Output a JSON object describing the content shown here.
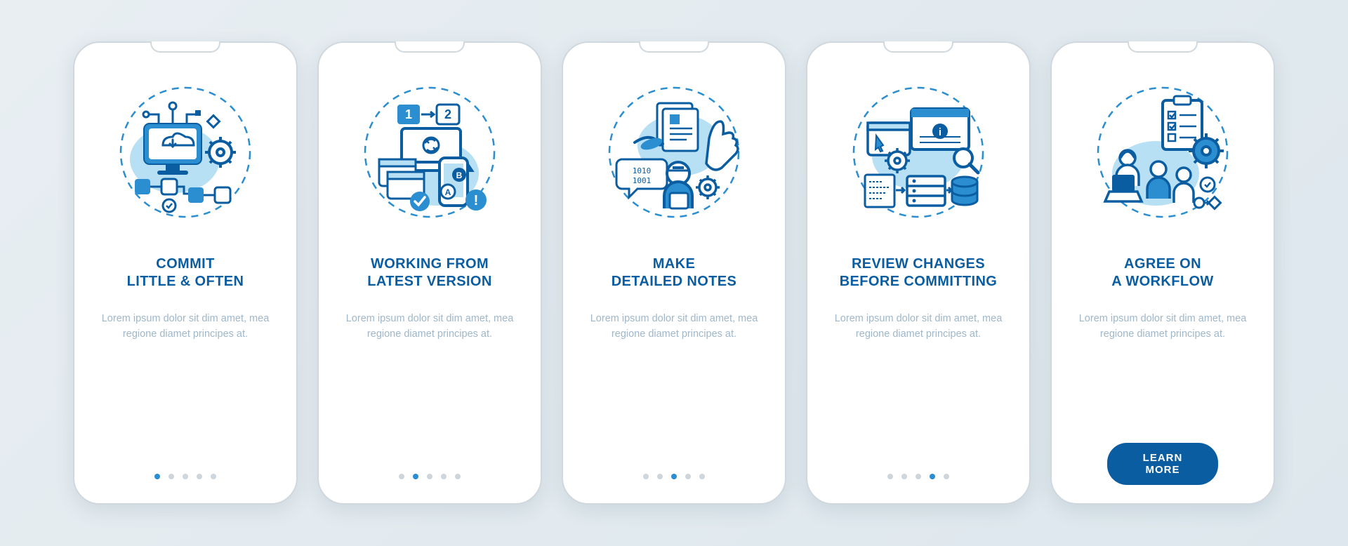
{
  "colors": {
    "primary": "#0b5da1",
    "accent": "#2a8ed0",
    "light": "#b8e0f5",
    "muted": "#9fb7c9",
    "dotInactive": "#cdd6dc"
  },
  "body_text": "Lorem ipsum dolor sit dim amet, mea regione diamet principes at.",
  "cta_label": "LEARN MORE",
  "screens": [
    {
      "title": "COMMIT\nLITTLE & OFTEN",
      "icon": "commit-often-icon",
      "active": 0
    },
    {
      "title": "WORKING FROM\nLATEST VERSION",
      "icon": "latest-version-icon",
      "active": 1
    },
    {
      "title": "MAKE\nDETAILED NOTES",
      "icon": "detailed-notes-icon",
      "active": 2
    },
    {
      "title": "REVIEW CHANGES\nBEFORE COMMITTING",
      "icon": "review-changes-icon",
      "active": 3
    },
    {
      "title": "AGREE ON\nA WORKFLOW",
      "icon": "agree-workflow-icon",
      "active": 4,
      "cta": true
    }
  ],
  "dot_count": 5
}
